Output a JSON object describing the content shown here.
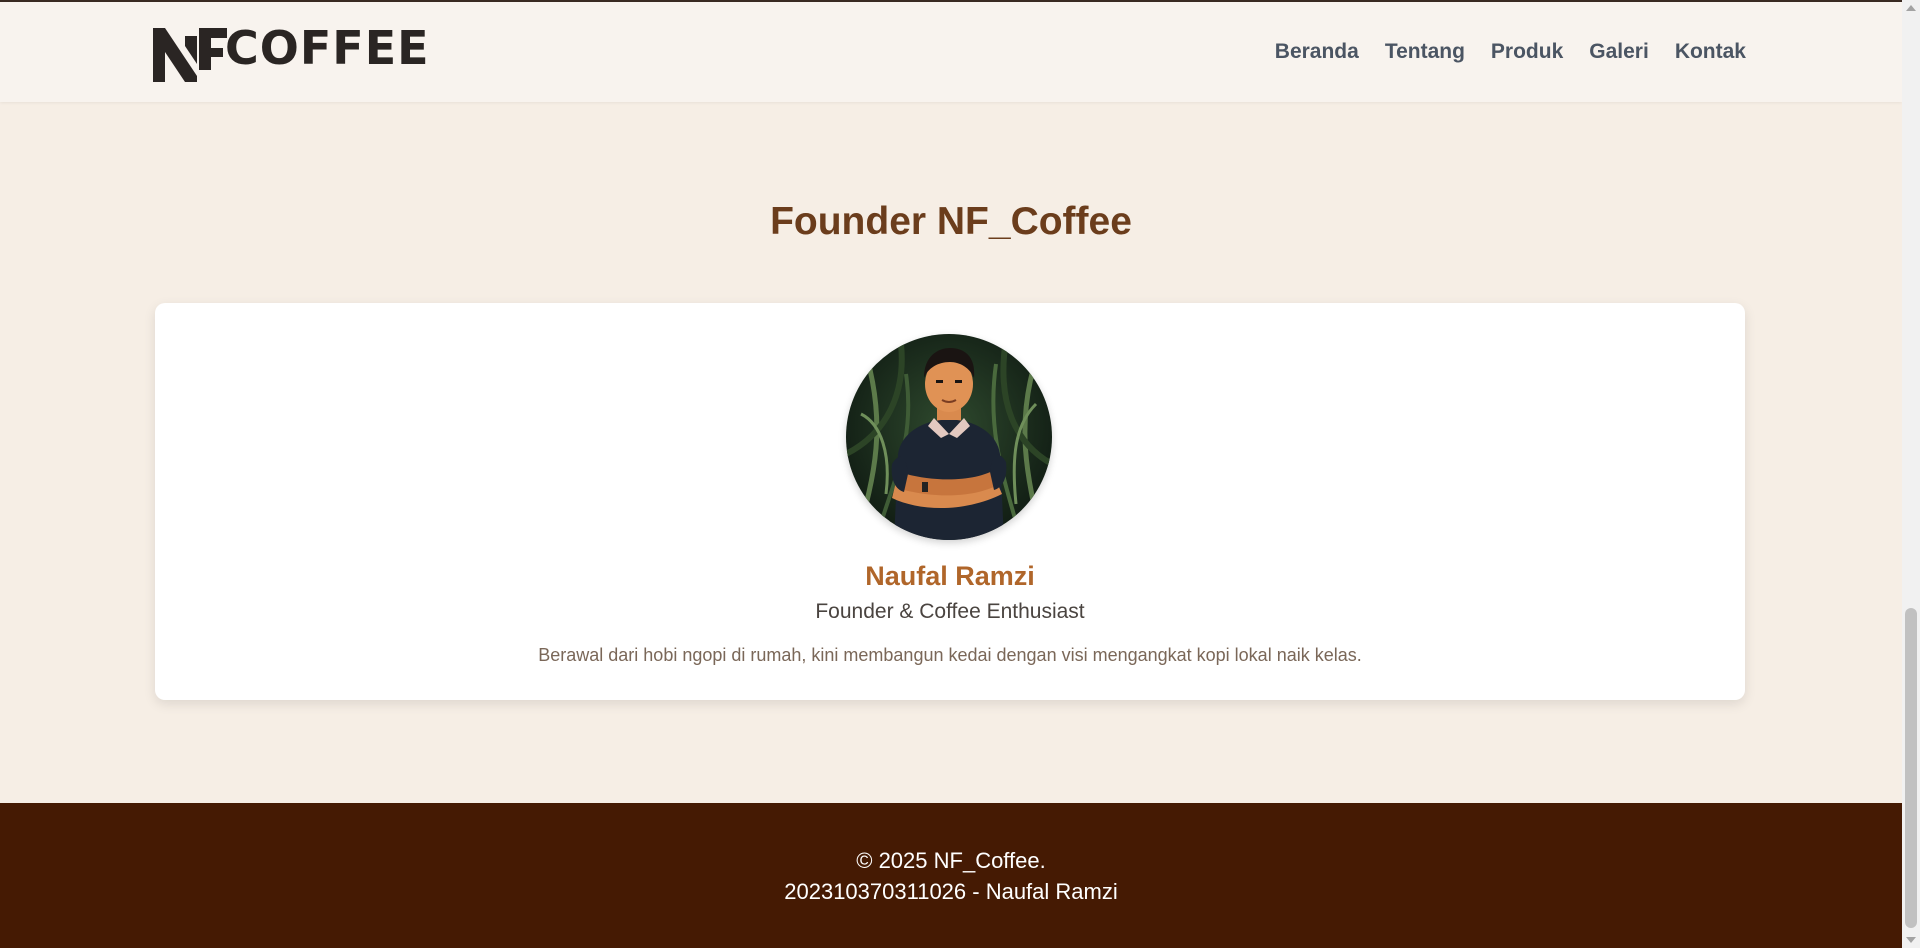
{
  "header": {
    "logo_text": "COFFEE",
    "logo_mark_icon": "nf-logo-mark",
    "nav": [
      {
        "label": "Beranda"
      },
      {
        "label": "Tentang"
      },
      {
        "label": "Produk"
      },
      {
        "label": "Galeri"
      },
      {
        "label": "Kontak"
      }
    ]
  },
  "founder": {
    "section_title": "Founder NF_Coffee",
    "avatar_icon": "founder-avatar-illustration",
    "name": "Naufal Ramzi",
    "role": "Founder & Coffee Enthusiast",
    "bio": "Berawal dari hobi ngopi di rumah, kini membangun kedai dengan visi mengangkat kopi lokal naik kelas."
  },
  "footer": {
    "copyright": "© 2025 NF_Coffee.",
    "credit": "202310370311026 - Naufal Ramzi"
  },
  "colors": {
    "page_bg": "#f6eee5",
    "heading_brown": "#6b3d1c",
    "name_accent": "#b0662a",
    "footer_bg": "#451a03",
    "nav_text": "#4b5563"
  }
}
